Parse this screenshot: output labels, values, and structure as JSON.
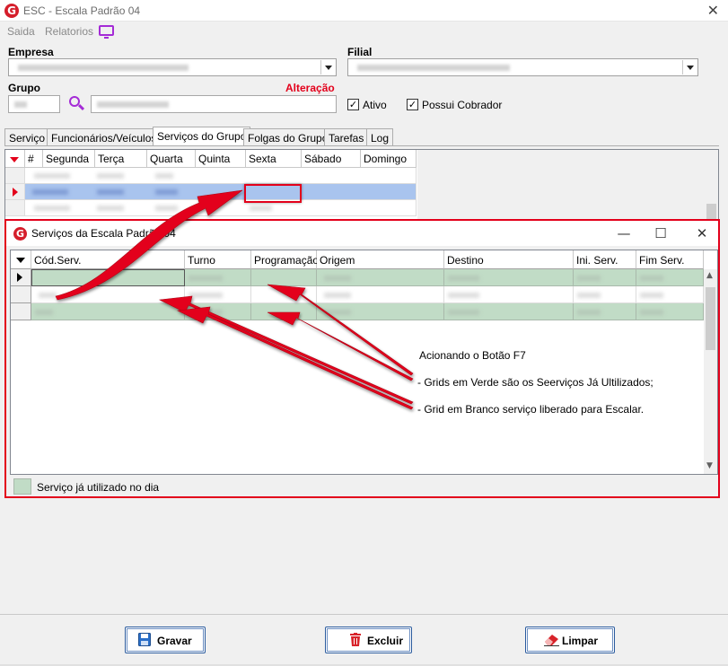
{
  "window": {
    "title": "ESC - Escala Padrão 04",
    "close": "✕"
  },
  "menu": {
    "items": [
      "Saida",
      "Relatorios"
    ]
  },
  "form": {
    "empresa_label": "Empresa",
    "filial_label": "Filial",
    "grupo_label": "Grupo",
    "status_text": "Alteração",
    "ativo_label": "Ativo",
    "possui_cobrador_label": "Possui Cobrador",
    "ativo_checked": "✓",
    "cobrador_checked": "✓"
  },
  "tabs": [
    "Serviço",
    "Funcionários/Veículos",
    "Serviços do Grupo",
    "Folgas do Grupo",
    "Tarefas",
    "Log"
  ],
  "group_grid": {
    "columns": [
      "#",
      "Segunda",
      "Terça",
      "Quarta",
      "Quinta",
      "Sexta",
      "Sábado",
      "Domingo"
    ]
  },
  "dialog": {
    "title": "Serviços da Escala Padrão 04",
    "columns": [
      "Cód.Serv.",
      "Turno",
      "Programação",
      "Origem",
      "Destino",
      "Ini. Serv.",
      "Fim Serv."
    ],
    "legend": "Serviço já utilizado no dia",
    "minimize": "—",
    "maximize": "☐",
    "close": "✕"
  },
  "annotations": {
    "line1": "Acionando o Botão F7",
    "line2": "- Grids em Verde são os Seerviços Já Ultilizados;",
    "line3": "-  Grid em Branco serviço liberado para Escalar."
  },
  "buttons": {
    "save": "Gravar",
    "delete": "Excluir",
    "clear": "Limpar"
  },
  "colors": {
    "accent_red": "#e3001b",
    "icon_purple": "#a42bd6",
    "used_green": "#c1dcc6",
    "selected_blue": "#a9c4ee"
  }
}
